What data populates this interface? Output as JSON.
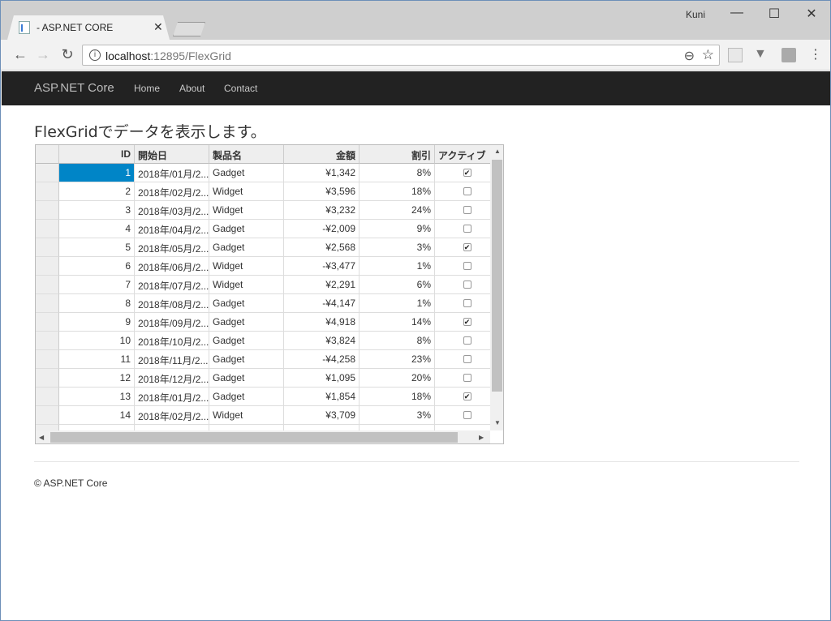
{
  "browser": {
    "tab_title": "- ASP.NET CORE",
    "profile": "Kuni",
    "url_host": "localhost",
    "url_path": ":12895/FlexGrid"
  },
  "site": {
    "brand": "ASP.NET Core",
    "nav": [
      "Home",
      "About",
      "Contact"
    ],
    "heading": "FlexGridでデータを表示します。",
    "footer": "© ASP.NET Core"
  },
  "grid": {
    "columns": [
      "ID",
      "開始日",
      "製品名",
      "金額",
      "割引",
      "アクティブ"
    ],
    "rows": [
      {
        "id": "1",
        "date": "2018年/01月/2...",
        "product": "Gadget",
        "amount": "¥1,342",
        "discount": "8%",
        "active": true
      },
      {
        "id": "2",
        "date": "2018年/02月/2...",
        "product": "Widget",
        "amount": "¥3,596",
        "discount": "18%",
        "active": false
      },
      {
        "id": "3",
        "date": "2018年/03月/2...",
        "product": "Widget",
        "amount": "¥3,232",
        "discount": "24%",
        "active": false
      },
      {
        "id": "4",
        "date": "2018年/04月/2...",
        "product": "Gadget",
        "amount": "-¥2,009",
        "discount": "9%",
        "active": false
      },
      {
        "id": "5",
        "date": "2018年/05月/2...",
        "product": "Gadget",
        "amount": "¥2,568",
        "discount": "3%",
        "active": true
      },
      {
        "id": "6",
        "date": "2018年/06月/2...",
        "product": "Widget",
        "amount": "-¥3,477",
        "discount": "1%",
        "active": false
      },
      {
        "id": "7",
        "date": "2018年/07月/2...",
        "product": "Widget",
        "amount": "¥2,291",
        "discount": "6%",
        "active": false
      },
      {
        "id": "8",
        "date": "2018年/08月/2...",
        "product": "Gadget",
        "amount": "-¥4,147",
        "discount": "1%",
        "active": false
      },
      {
        "id": "9",
        "date": "2018年/09月/2...",
        "product": "Gadget",
        "amount": "¥4,918",
        "discount": "14%",
        "active": true
      },
      {
        "id": "10",
        "date": "2018年/10月/2...",
        "product": "Gadget",
        "amount": "¥3,824",
        "discount": "8%",
        "active": false
      },
      {
        "id": "11",
        "date": "2018年/11月/2...",
        "product": "Gadget",
        "amount": "-¥4,258",
        "discount": "23%",
        "active": false
      },
      {
        "id": "12",
        "date": "2018年/12月/2...",
        "product": "Gadget",
        "amount": "¥1,095",
        "discount": "20%",
        "active": false
      },
      {
        "id": "13",
        "date": "2018年/01月/2...",
        "product": "Gadget",
        "amount": "¥1,854",
        "discount": "18%",
        "active": true
      },
      {
        "id": "14",
        "date": "2018年/02月/2...",
        "product": "Widget",
        "amount": "¥3,709",
        "discount": "3%",
        "active": false
      }
    ]
  },
  "colors": {
    "selection": "#0085c7",
    "navbar": "#222222"
  }
}
